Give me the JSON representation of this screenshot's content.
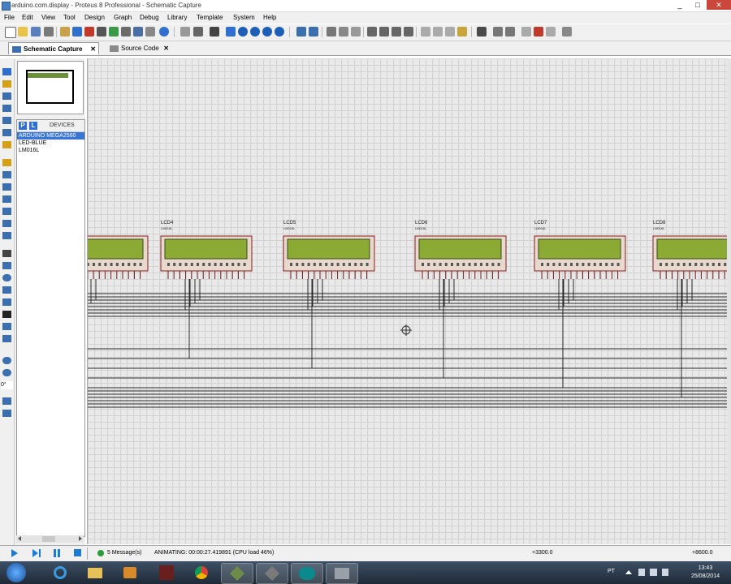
{
  "window": {
    "title": "arduino.com.display - Proteus 8 Professional - Schematic Capture",
    "controls": [
      "_",
      "□",
      "✕"
    ]
  },
  "menu": [
    "File",
    "Edit",
    "View",
    "Tool",
    "Design",
    "Graph",
    "Debug",
    "Library",
    "Template",
    "System",
    "Help"
  ],
  "tabs": [
    {
      "label": "Schematic Capture",
      "close": "✕",
      "active": true
    },
    {
      "label": "Source Code",
      "close": "✕",
      "active": false
    }
  ],
  "devices": {
    "header_p": "P",
    "header_l": "L",
    "title": "DEVICES",
    "items": [
      "ARDUINO MEGA2560",
      "LED-BLUE",
      "LM016L"
    ],
    "selected_index": 0
  },
  "left_toolbar": {
    "rotation_label": "0°"
  },
  "schematic": {
    "lcd_refs": [
      "",
      "LCD4",
      "LCD5",
      "LCD6",
      "LCD7",
      "LCD8"
    ],
    "lcd_part": "LM016L",
    "screen_color": "#8aaa33",
    "body_color": "#e8d9cf",
    "outline_color": "#8b1a1a",
    "wire_color": "#2a2a2a"
  },
  "status": {
    "messages": "5 Message(s)",
    "animating": "ANIMATING: 00:00:27.419891 (CPU load 46%)",
    "coord_x": "+3300.0",
    "coord_y": "+8600.0"
  },
  "taskbar": {
    "lang": "PT",
    "time": "13:43",
    "date": "25/08/2014"
  },
  "icons": [
    "proteus-icon",
    "new-icon",
    "open-icon",
    "save-icon",
    "home-icon",
    "undo-icon",
    "redo-icon",
    "cut-icon",
    "copy-icon",
    "paste-icon",
    "zoom-in-icon",
    "zoom-out-icon",
    "play-icon",
    "step-icon",
    "pause-icon",
    "stop-icon",
    "start-orb-icon",
    "ie-icon",
    "explorer-icon",
    "media-icon",
    "chrome-icon",
    "arduino-icon"
  ]
}
